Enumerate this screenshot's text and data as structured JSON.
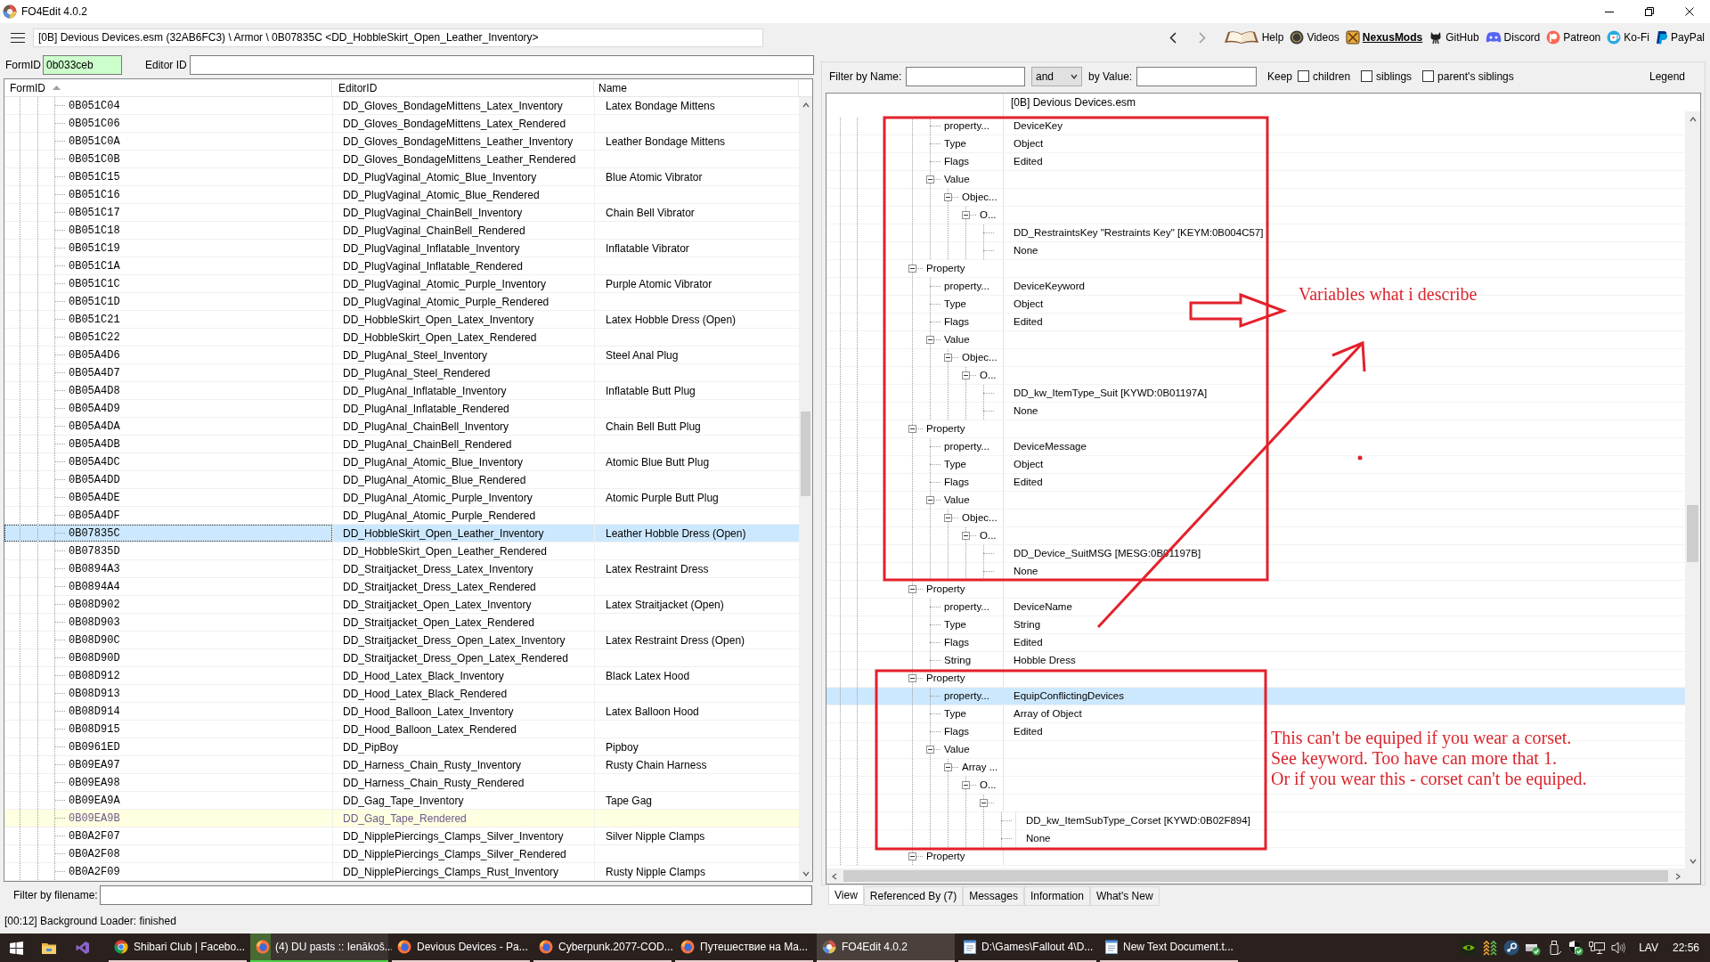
{
  "window": {
    "title": "FO4Edit 4.0.2"
  },
  "toolbar": {
    "path": "[0B] Devious Devices.esm (32AB6FC3) \\ Armor \\ 0B07835C <DD_HobbleSkirt_Open_Leather_Inventory>",
    "back": {
      "disabled": false
    },
    "forward": {
      "disabled": true
    },
    "links": [
      {
        "kind": "book",
        "label": "Help",
        "bold": false
      },
      {
        "kind": "coin",
        "label": "Videos",
        "bold": false
      },
      {
        "kind": "crate",
        "label": "NexusMods",
        "bold": true
      },
      {
        "kind": "cat",
        "label": "GitHub",
        "bold": false
      },
      {
        "kind": "controller",
        "label": "Discord",
        "bold": false
      },
      {
        "kind": "patreon",
        "label": "Patreon",
        "bold": false
      },
      {
        "kind": "cup",
        "label": "Ko-Fi",
        "bold": false
      },
      {
        "kind": "paypal",
        "label": "PayPal",
        "bold": false
      }
    ]
  },
  "search": {
    "formid_label": "FormID",
    "formid_value": "0b033ceb",
    "editorid_label": "Editor ID"
  },
  "record_list": {
    "columns": [
      {
        "label": "FormID",
        "sorted": true
      },
      {
        "label": "EditorID",
        "sorted": false
      },
      {
        "label": "Name",
        "sorted": false
      }
    ],
    "rows": [
      {
        "form_id": "0B051C04",
        "editor_id": "DD_Gloves_BondageMittens_Latex_Inventory",
        "name": "Latex Bondage Mittens",
        "selected": false,
        "highlighted": false
      },
      {
        "form_id": "0B051C06",
        "editor_id": "DD_Gloves_BondageMittens_Latex_Rendered",
        "selected": false,
        "highlighted": false
      },
      {
        "form_id": "0B051C0A",
        "editor_id": "DD_Gloves_BondageMittens_Leather_Inventory",
        "name": "Leather Bondage Mittens",
        "selected": false,
        "highlighted": false
      },
      {
        "form_id": "0B051C0B",
        "editor_id": "DD_Gloves_BondageMittens_Leather_Rendered",
        "selected": false,
        "highlighted": false
      },
      {
        "form_id": "0B051C15",
        "editor_id": "DD_PlugVaginal_Atomic_Blue_Inventory",
        "name": "Blue Atomic Vibrator",
        "selected": false,
        "highlighted": false
      },
      {
        "form_id": "0B051C16",
        "editor_id": "DD_PlugVaginal_Atomic_Blue_Rendered",
        "selected": false,
        "highlighted": false
      },
      {
        "form_id": "0B051C17",
        "editor_id": "DD_PlugVaginal_ChainBell_Inventory",
        "name": "Chain Bell Vibrator",
        "selected": false,
        "highlighted": false
      },
      {
        "form_id": "0B051C18",
        "editor_id": "DD_PlugVaginal_ChainBell_Rendered",
        "selected": false,
        "highlighted": false
      },
      {
        "form_id": "0B051C19",
        "editor_id": "DD_PlugVaginal_Inflatable_Inventory",
        "name": "Inflatable Vibrator",
        "selected": false,
        "highlighted": false
      },
      {
        "form_id": "0B051C1A",
        "editor_id": "DD_PlugVaginal_Inflatable_Rendered",
        "selected": false,
        "highlighted": false
      },
      {
        "form_id": "0B051C1C",
        "editor_id": "DD_PlugVaginal_Atomic_Purple_Inventory",
        "name": "Purple Atomic Vibrator",
        "selected": false,
        "highlighted": false
      },
      {
        "form_id": "0B051C1D",
        "editor_id": "DD_PlugVaginal_Atomic_Purple_Rendered",
        "selected": false,
        "highlighted": false
      },
      {
        "form_id": "0B051C21",
        "editor_id": "DD_HobbleSkirt_Open_Latex_Inventory",
        "name": "Latex Hobble Dress (Open)",
        "selected": false,
        "highlighted": false
      },
      {
        "form_id": "0B051C22",
        "editor_id": "DD_HobbleSkirt_Open_Latex_Rendered",
        "selected": false,
        "highlighted": false
      },
      {
        "form_id": "0B05A4D6",
        "editor_id": "DD_PlugAnal_Steel_Inventory",
        "name": "Steel Anal Plug",
        "selected": false,
        "highlighted": false
      },
      {
        "form_id": "0B05A4D7",
        "editor_id": "DD_PlugAnal_Steel_Rendered",
        "selected": false,
        "highlighted": false
      },
      {
        "form_id": "0B05A4D8",
        "editor_id": "DD_PlugAnal_Inflatable_Inventory",
        "name": "Inflatable Butt Plug",
        "selected": false,
        "highlighted": false
      },
      {
        "form_id": "0B05A4D9",
        "editor_id": "DD_PlugAnal_Inflatable_Rendered",
        "selected": false,
        "highlighted": false
      },
      {
        "form_id": "0B05A4DA",
        "editor_id": "DD_PlugAnal_ChainBell_Inventory",
        "name": "Chain Bell Butt Plug",
        "selected": false,
        "highlighted": false
      },
      {
        "form_id": "0B05A4DB",
        "editor_id": "DD_PlugAnal_ChainBell_Rendered",
        "selected": false,
        "highlighted": false
      },
      {
        "form_id": "0B05A4DC",
        "editor_id": "DD_PlugAnal_Atomic_Blue_Inventory",
        "name": "Atomic Blue Butt Plug",
        "selected": false,
        "highlighted": false
      },
      {
        "form_id": "0B05A4DD",
        "editor_id": "DD_PlugAnal_Atomic_Blue_Rendered",
        "selected": false,
        "highlighted": false
      },
      {
        "form_id": "0B05A4DE",
        "editor_id": "DD_PlugAnal_Atomic_Purple_Inventory",
        "name": "Atomic Purple Butt Plug",
        "selected": false,
        "highlighted": false
      },
      {
        "form_id": "0B05A4DF",
        "editor_id": "DD_PlugAnal_Atomic_Purple_Rendered",
        "selected": false,
        "highlighted": false
      },
      {
        "form_id": "0B07835C",
        "editor_id": "DD_HobbleSkirt_Open_Leather_Inventory",
        "name": "Leather Hobble Dress (Open)",
        "selected": true,
        "highlighted": false
      },
      {
        "form_id": "0B07835D",
        "editor_id": "DD_HobbleSkirt_Open_Leather_Rendered",
        "selected": false,
        "highlighted": false
      },
      {
        "form_id": "0B0894A3",
        "editor_id": "DD_Straitjacket_Dress_Latex_Inventory",
        "name": "Latex Restraint Dress",
        "selected": false,
        "highlighted": false
      },
      {
        "form_id": "0B0894A4",
        "editor_id": "DD_Straitjacket_Dress_Latex_Rendered",
        "selected": false,
        "highlighted": false
      },
      {
        "form_id": "0B08D902",
        "editor_id": "DD_Straitjacket_Open_Latex_Inventory",
        "name": "Latex Straitjacket (Open)",
        "selected": false,
        "highlighted": false
      },
      {
        "form_id": "0B08D903",
        "editor_id": "DD_Straitjacket_Open_Latex_Rendered",
        "selected": false,
        "highlighted": false
      },
      {
        "form_id": "0B08D90C",
        "editor_id": "DD_Straitjacket_Dress_Open_Latex_Inventory",
        "name": "Latex Restraint Dress (Open)",
        "selected": false,
        "highlighted": false
      },
      {
        "form_id": "0B08D90D",
        "editor_id": "DD_Straitjacket_Dress_Open_Latex_Rendered",
        "selected": false,
        "highlighted": false
      },
      {
        "form_id": "0B08D912",
        "editor_id": "DD_Hood_Latex_Black_Inventory",
        "name": "Black Latex Hood",
        "selected": false,
        "highlighted": false
      },
      {
        "form_id": "0B08D913",
        "editor_id": "DD_Hood_Latex_Black_Rendered",
        "selected": false,
        "highlighted": false
      },
      {
        "form_id": "0B08D914",
        "editor_id": "DD_Hood_Balloon_Latex_Inventory",
        "name": "Latex Balloon Hood",
        "selected": false,
        "highlighted": false
      },
      {
        "form_id": "0B08D915",
        "editor_id": "DD_Hood_Balloon_Latex_Rendered",
        "selected": false,
        "highlighted": false
      },
      {
        "form_id": "0B0961ED",
        "editor_id": "DD_PipBoy",
        "name": "Pipboy",
        "selected": false,
        "highlighted": false
      },
      {
        "form_id": "0B09EA97",
        "editor_id": "DD_Harness_Chain_Rusty_Inventory",
        "name": "Rusty Chain Harness",
        "selected": false,
        "highlighted": false
      },
      {
        "form_id": "0B09EA98",
        "editor_id": "DD_Harness_Chain_Rusty_Rendered",
        "selected": false,
        "highlighted": false
      },
      {
        "form_id": "0B09EA9A",
        "editor_id": "DD_Gag_Tape_Inventory",
        "name": "Tape Gag",
        "selected": false,
        "highlighted": false
      },
      {
        "form_id": "0B09EA9B",
        "editor_id": "DD_Gag_Tape_Rendered",
        "selected": false,
        "highlighted": true
      },
      {
        "form_id": "0B0A2F07",
        "editor_id": "DD_NipplePiercings_Clamps_Silver_Inventory",
        "name": "Silver Nipple Clamps",
        "selected": false,
        "highlighted": false
      },
      {
        "form_id": "0B0A2F08",
        "editor_id": "DD_NipplePiercings_Clamps_Silver_Rendered",
        "selected": false,
        "highlighted": false
      },
      {
        "form_id": "0B0A2F09",
        "editor_id": "DD_NipplePiercings_Clamps_Rust_Inventory",
        "name": "Rusty Nipple Clamps",
        "selected": false,
        "highlighted": false
      }
    ]
  },
  "file_filter": {
    "label": "Filter by filename:"
  },
  "record_view": {
    "filter": {
      "name_label": "Filter by Name:",
      "operator": "and",
      "value_label": "by Value:",
      "keep_label": "Keep",
      "options": [
        {
          "label": "children",
          "checked": false
        },
        {
          "label": "siblings",
          "checked": false
        },
        {
          "label": "parent's siblings",
          "checked": false
        }
      ],
      "legend": "Legend"
    },
    "header": "[0B] Devious Devices.esm",
    "nodes": [
      {
        "children": [
          {
            "name": "property...",
            "value": "DeviceKey",
            "selected": false
          },
          {
            "name": "Type",
            "value": "Object",
            "selected": false
          },
          {
            "name": "Flags",
            "value": "Edited",
            "selected": false
          },
          {
            "name": "Value",
            "expanded": true,
            "selected": false,
            "children": [
              {
                "name": "Objec...",
                "expanded": true,
                "selected": false,
                "children": [
                  {
                    "name": "O...",
                    "expanded": true,
                    "selected": false,
                    "children": [
                      {
                        "value": "DD_RestraintsKey \"Restraints Key\" [KEYM:0B004C57]",
                        "selected": false
                      },
                      {
                        "value": "None",
                        "selected": false
                      }
                    ]
                  }
                ]
              }
            ]
          }
        ]
      },
      {
        "name": "Property",
        "expanded": true,
        "selected": false,
        "children": [
          {
            "name": "property...",
            "value": "DeviceKeyword",
            "selected": false
          },
          {
            "name": "Type",
            "value": "Object",
            "selected": false
          },
          {
            "name": "Flags",
            "value": "Edited",
            "selected": false
          },
          {
            "name": "Value",
            "expanded": true,
            "selected": false,
            "children": [
              {
                "name": "Objec...",
                "expanded": true,
                "selected": false,
                "children": [
                  {
                    "name": "O...",
                    "expanded": true,
                    "selected": false,
                    "children": [
                      {
                        "value": "DD_kw_ItemType_Suit [KYWD:0B01197A]",
                        "selected": false
                      },
                      {
                        "value": "None",
                        "selected": false
                      }
                    ]
                  }
                ]
              }
            ]
          }
        ]
      },
      {
        "name": "Property",
        "expanded": true,
        "selected": false,
        "children": [
          {
            "name": "property...",
            "value": "DeviceMessage",
            "selected": false
          },
          {
            "name": "Type",
            "value": "Object",
            "selected": false
          },
          {
            "name": "Flags",
            "value": "Edited",
            "selected": false
          },
          {
            "name": "Value",
            "expanded": true,
            "selected": false,
            "children": [
              {
                "name": "Objec...",
                "expanded": true,
                "selected": false,
                "children": [
                  {
                    "name": "O...",
                    "expanded": true,
                    "selected": false,
                    "children": [
                      {
                        "value": "DD_Device_SuitMSG [MESG:0B01197B]",
                        "selected": false
                      },
                      {
                        "value": "None",
                        "selected": false
                      }
                    ]
                  }
                ]
              }
            ]
          }
        ]
      },
      {
        "name": "Property",
        "expanded": true,
        "selected": false,
        "children": [
          {
            "name": "property...",
            "value": "DeviceName",
            "selected": false
          },
          {
            "name": "Type",
            "value": "String",
            "selected": false
          },
          {
            "name": "Flags",
            "value": "Edited",
            "selected": false
          },
          {
            "name": "String",
            "value": "Hobble Dress",
            "selected": false
          }
        ]
      },
      {
        "name": "Property",
        "expanded": true,
        "selected": false,
        "children": [
          {
            "name": "property...",
            "value": "EquipConflictingDevices",
            "selected": true
          },
          {
            "name": "Type",
            "value": "Array of Object",
            "selected": false
          },
          {
            "name": "Flags",
            "value": "Edited",
            "selected": false
          },
          {
            "name": "Value",
            "expanded": true,
            "selected": false,
            "children": [
              {
                "name": "Array ...",
                "expanded": true,
                "selected": false,
                "children": [
                  {
                    "name": "O...",
                    "expanded": true,
                    "selected": false,
                    "children": [
                      {
                        "expanded": true,
                        "selected": false,
                        "children": [
                          {
                            "value": "DD_kw_ItemSubType_Corset [KYWD:0B02F894]",
                            "selected": false
                          },
                          {
                            "value": "None",
                            "selected": false
                          }
                        ]
                      }
                    ]
                  }
                ]
              }
            ]
          }
        ]
      },
      {
        "name": "Property",
        "expanded": true,
        "selected": false
      }
    ],
    "tabs": [
      {
        "label": "View",
        "selected": true
      },
      {
        "label": "Referenced By (7)",
        "selected": false
      },
      {
        "label": "Messages",
        "selected": false
      },
      {
        "label": "Information",
        "selected": false
      },
      {
        "label": "What's New",
        "selected": false
      }
    ]
  },
  "annotations": [
    {
      "kind": "arrow_note",
      "lines": [
        "Variables what i describe"
      ]
    },
    {
      "kind": "box_note",
      "lines": [
        "This can't be equiped if you wear a corset.",
        "See keyword. Too have can more that 1.",
        "Or if you wear this - corset can't be equiped."
      ]
    }
  ],
  "status_bar": {
    "text": "[00:12] Background Loader: finished"
  },
  "taskbar": {
    "tasks": [
      {
        "kind": "ring",
        "label": "Shibari Club | Facebo...",
        "selected": false
      },
      {
        "kind": "fox",
        "label": "(4) DU pasts :: Ienākoš...",
        "selected": false,
        "level": 0.15
      },
      {
        "kind": "fox",
        "label": "Devious Devices - Pa...",
        "selected": false
      },
      {
        "kind": "fox",
        "label": "Cyberpunk.2077-COD...",
        "selected": false
      },
      {
        "kind": "fox",
        "label": "Путешествие на Ма...",
        "selected": false
      },
      {
        "kind": "app",
        "label": "FO4Edit 4.0.2",
        "selected": true
      },
      {
        "kind": "note",
        "label": "D:\\Games\\Fallout 4\\D...",
        "selected": false
      },
      {
        "kind": "note",
        "label": "New Text Document.t...",
        "selected": false
      }
    ],
    "language": "LAV",
    "time": "22:56"
  }
}
